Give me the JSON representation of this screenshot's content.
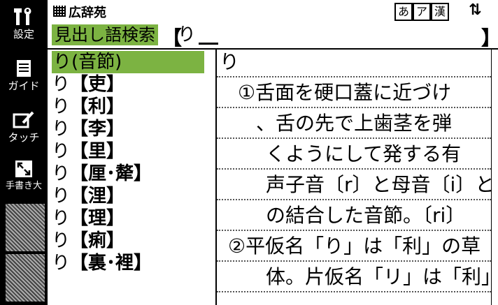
{
  "header": {
    "title": "広辞苑",
    "modes": [
      "あ",
      "ア",
      "漢"
    ],
    "scroll_icon": "up-down-arrows-icon"
  },
  "sidebar": {
    "buttons": [
      {
        "label": "設定",
        "icon": "tools-icon"
      },
      {
        "label": "ガイド",
        "icon": "book-icon"
      },
      {
        "label": "タッチ",
        "icon": "touch-pen-icon"
      },
      {
        "label": "手書き大",
        "icon": "expand-icon"
      }
    ]
  },
  "search": {
    "label": "見出し語検索",
    "value": "り"
  },
  "results": [
    {
      "head": "り",
      "word": "(音節)",
      "selected": true
    },
    {
      "head": "り",
      "word": "【吏】"
    },
    {
      "head": "り",
      "word": "【利】"
    },
    {
      "head": "り",
      "word": "【李】"
    },
    {
      "head": "り",
      "word": "【里】"
    },
    {
      "head": "り",
      "word": "【厘･犛】"
    },
    {
      "head": "り",
      "word": "【浬】"
    },
    {
      "head": "り",
      "word": "【理】"
    },
    {
      "head": "り",
      "word": "【痢】"
    },
    {
      "head": "り",
      "word": "【裏･裡】"
    }
  ],
  "definition": {
    "headword": "り",
    "lines": [
      "①舌面を硬口蓋に近づけ",
      "、舌の先で上歯茎を弾",
      "くようにして発する有",
      "声子音〔r〕と母音〔i〕と",
      "の結合した音節。〔ri〕",
      "②平仮名「り」は「利」の草",
      "体。片仮名「リ」は「利」"
    ]
  },
  "colors": {
    "highlight": "#7cb342",
    "frame": "#000000"
  }
}
